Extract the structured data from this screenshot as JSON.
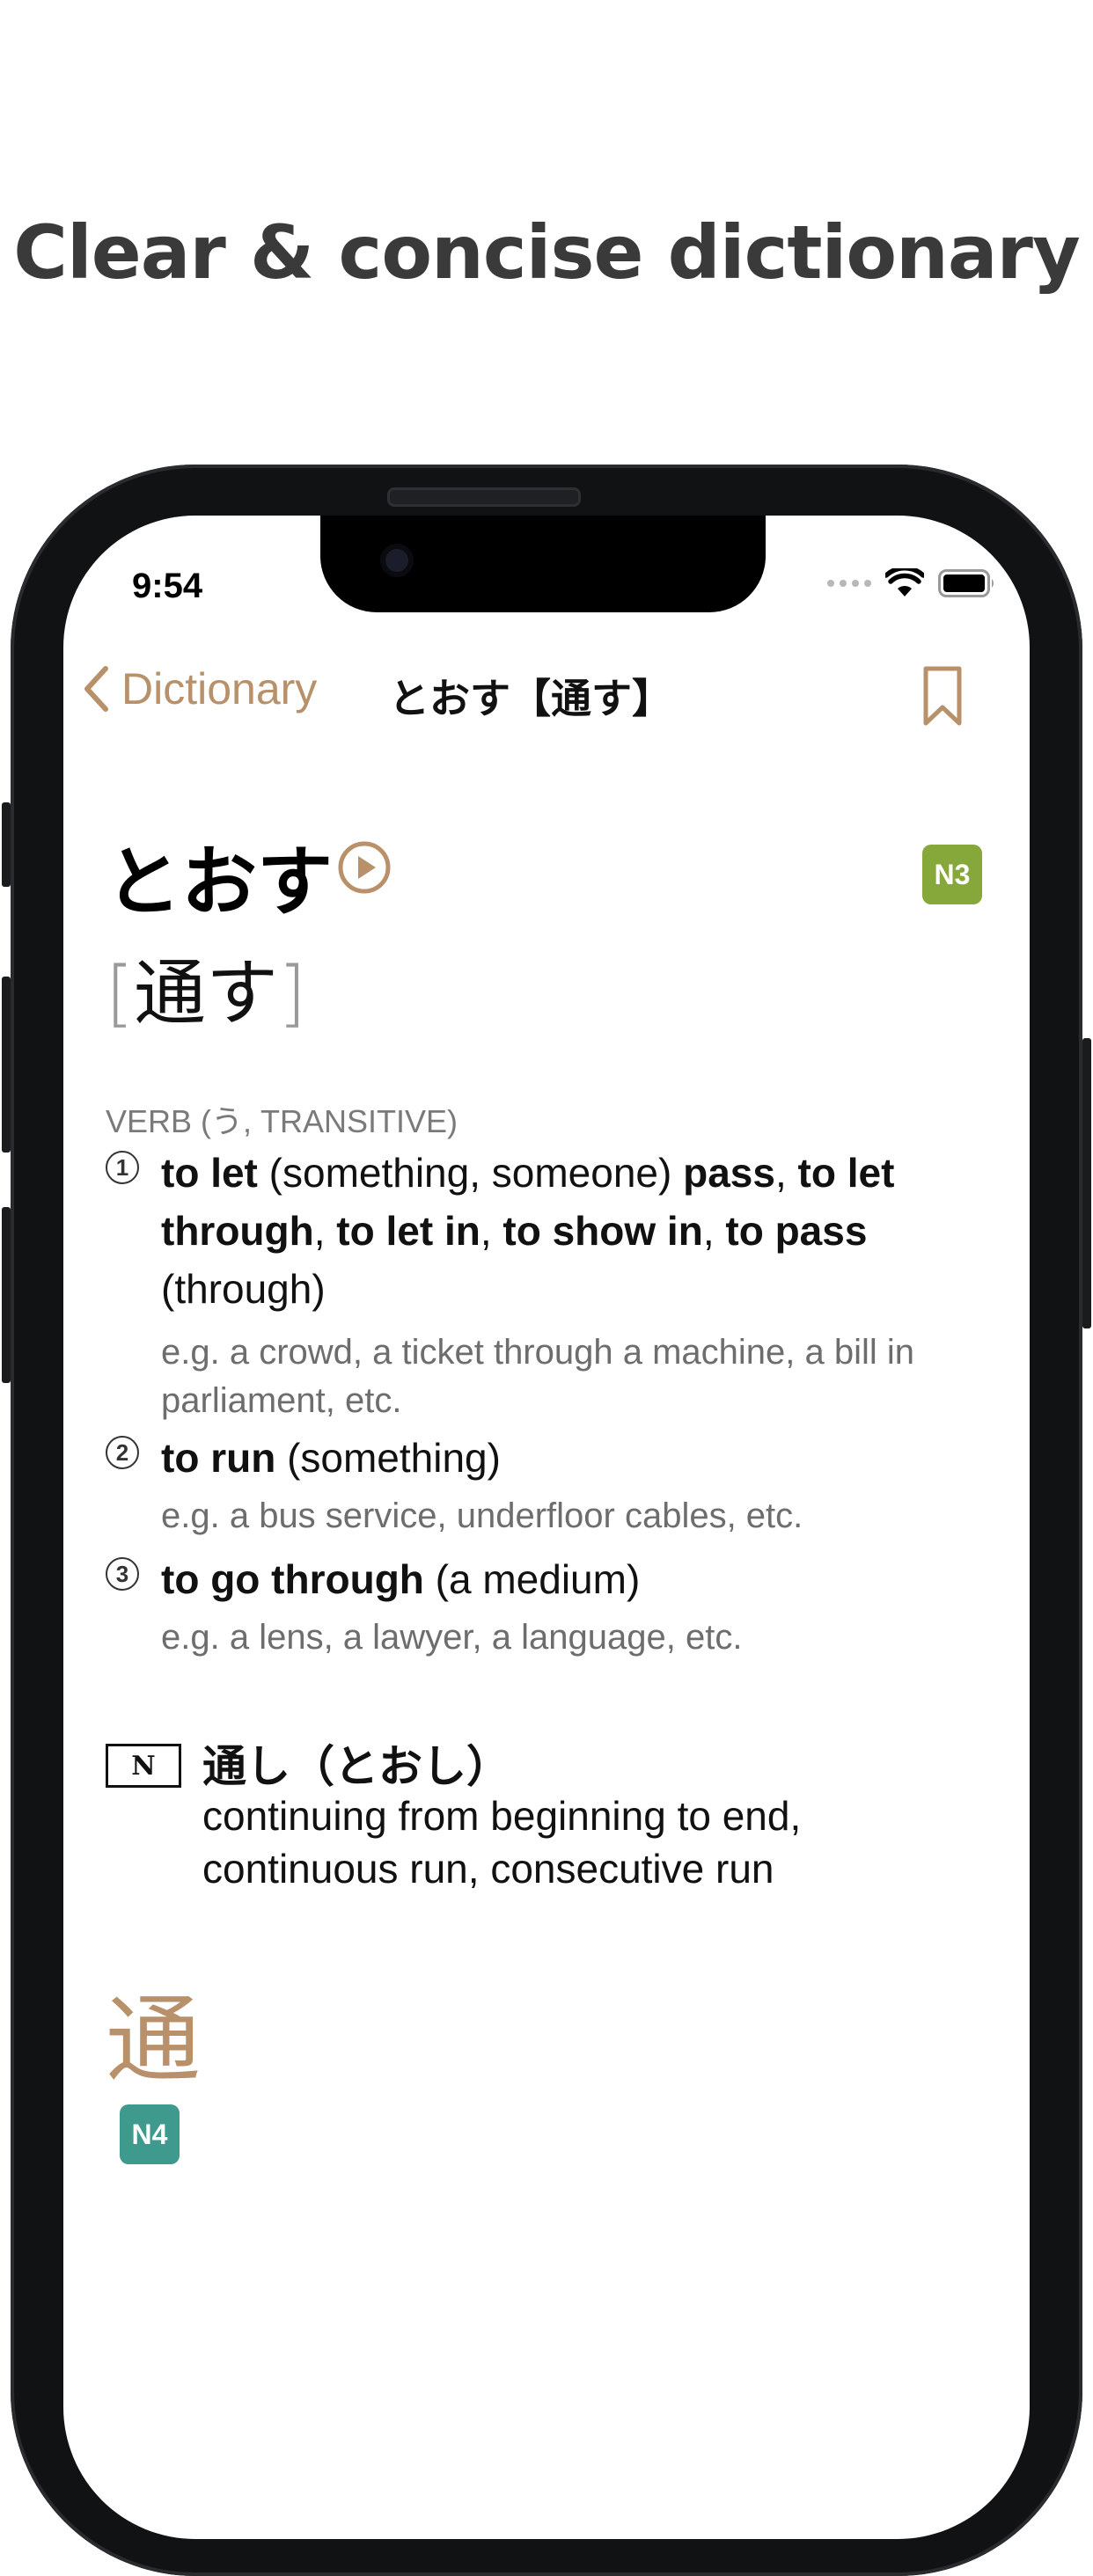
{
  "headline": "Clear & concise dictionary",
  "status_bar": {
    "time": "9:54"
  },
  "nav": {
    "back_label": "Dictionary",
    "title": "とおす【通す】"
  },
  "entry": {
    "reading": "とおす",
    "kanji": "通す",
    "bracket_open": "[",
    "bracket_close": "]",
    "jlpt_level": "N3",
    "part_of_speech": "VERB (う, TRANSITIVE)",
    "senses": [
      {
        "number": "1",
        "segments": [
          {
            "text": "to let",
            "bold": true
          },
          {
            "text": " (something, someone) ",
            "bold": false
          },
          {
            "text": "pass",
            "bold": true
          },
          {
            "text": ", ",
            "bold": false
          },
          {
            "text": "to let through",
            "bold": true
          },
          {
            "text": ", ",
            "bold": false
          },
          {
            "text": "to let in",
            "bold": true
          },
          {
            "text": ", ",
            "bold": false
          },
          {
            "text": "to show in",
            "bold": true
          },
          {
            "text": ", ",
            "bold": false
          },
          {
            "text": "to pass",
            "bold": true
          },
          {
            "text": " (through)",
            "bold": false
          }
        ],
        "example": "e.g. a crowd, a ticket through a machine, a bill in parliament, etc."
      },
      {
        "number": "2",
        "segments": [
          {
            "text": "to run",
            "bold": true
          },
          {
            "text": " (something)",
            "bold": false
          }
        ],
        "example": "e.g. a bus service, underfloor cables, etc."
      },
      {
        "number": "3",
        "segments": [
          {
            "text": "to go through",
            "bold": true
          },
          {
            "text": " (a medium)",
            "bold": false
          }
        ],
        "example": "e.g. a lens, a lawyer, a language, etc."
      }
    ]
  },
  "related": {
    "tag": "N",
    "word": "通し（とおし）",
    "meaning": "continuing from beginning to end, continuous run, consecutive run"
  },
  "kanji_section": {
    "character": "通",
    "jlpt_level": "N4"
  },
  "colors": {
    "accent": "#b8916a",
    "n3_badge": "#86a83a",
    "n4_badge": "#3e9a8c",
    "headline": "#3a3a3a"
  },
  "icons": [
    "chevron-left-icon",
    "bookmark-icon",
    "play-icon",
    "wifi-icon",
    "battery-icon",
    "signal-dots-icon"
  ]
}
